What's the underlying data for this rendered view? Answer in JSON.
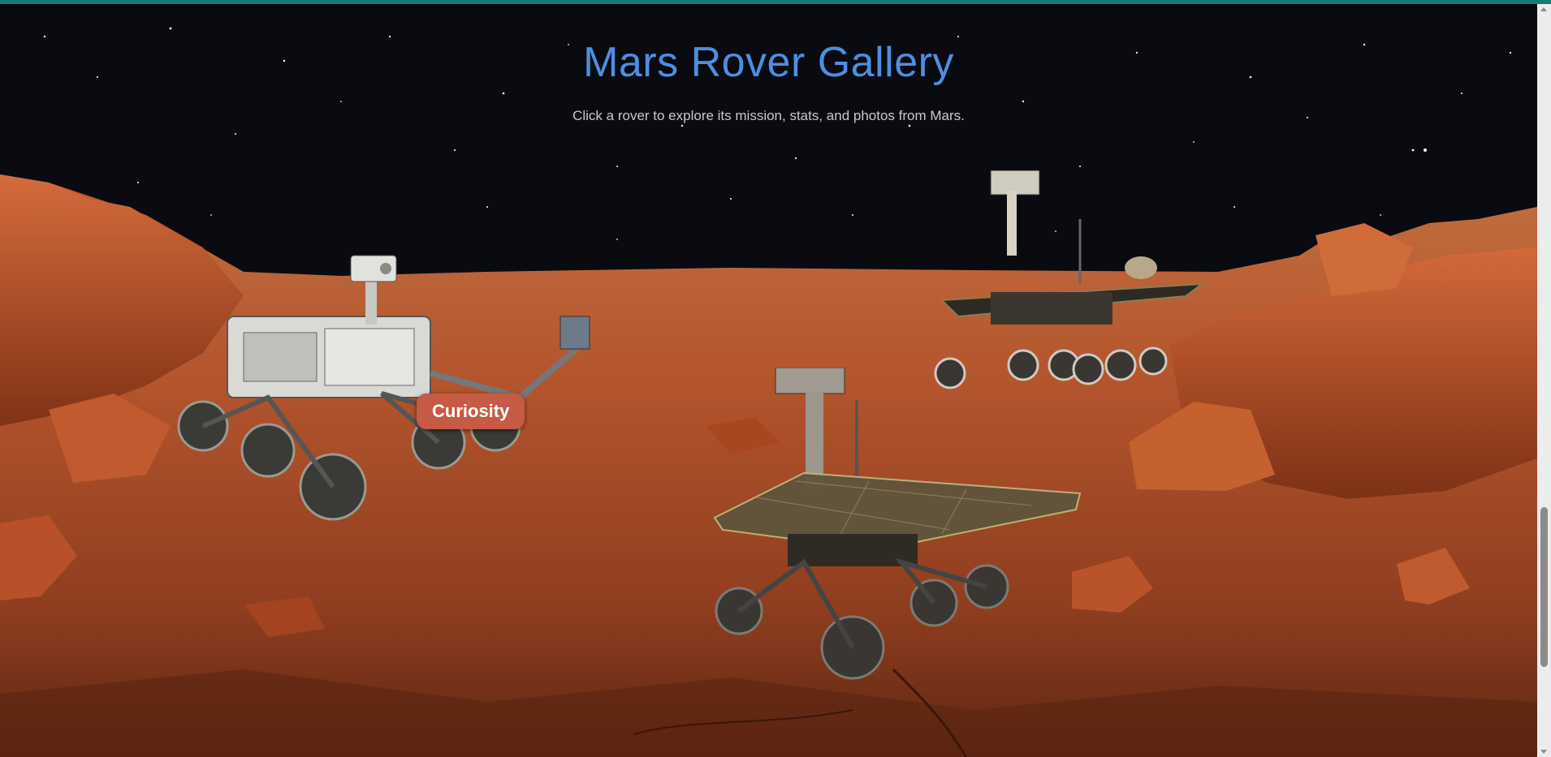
{
  "page": {
    "title": "Mars Rover Gallery",
    "subtitle": "Click a rover to explore its mission, stats, and photos from Mars."
  },
  "rovers": {
    "hovered_label": "Curiosity"
  },
  "colors": {
    "sky": "#0a0b10",
    "title": "#4c8fe0",
    "ground": "#b4552d",
    "label_bg": "#c65a44",
    "accent_bar": "#167b7b"
  },
  "icons": {
    "rover_1": "curiosity-rover",
    "rover_2": "spirit-rover",
    "rover_3": "opportunity-rover"
  }
}
